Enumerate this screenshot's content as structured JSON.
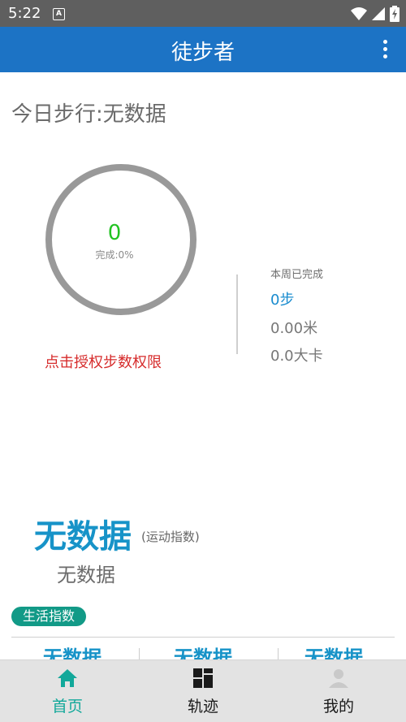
{
  "status": {
    "time": "5:22",
    "app_badge": "A"
  },
  "appbar": {
    "title": "徒步者"
  },
  "today": {
    "label": "今日步行:无数据"
  },
  "ring": {
    "value": "0",
    "subtitle": "完成:0%"
  },
  "auth": {
    "text": "点击授权步数权限"
  },
  "week": {
    "label": "本周已完成",
    "steps": "0步",
    "distance": "0.00米",
    "calories": "0.0大卡"
  },
  "sport": {
    "value": "无数据",
    "suffix": "(运动指数)",
    "subtitle": "无数据"
  },
  "life": {
    "pill": "生活指数",
    "cards": [
      "无数据",
      "无数据",
      "无数据"
    ]
  },
  "nav": {
    "items": [
      {
        "label": "首页",
        "icon": "home-icon"
      },
      {
        "label": "轨迹",
        "icon": "grid-icon"
      },
      {
        "label": "我的",
        "icon": "person-icon"
      }
    ]
  },
  "colors": {
    "appbar": "#1c73c5",
    "accent_teal": "#12a89a",
    "step_green": "#22c322",
    "auth_red": "#d62b2b",
    "index_blue": "#1793c8"
  }
}
